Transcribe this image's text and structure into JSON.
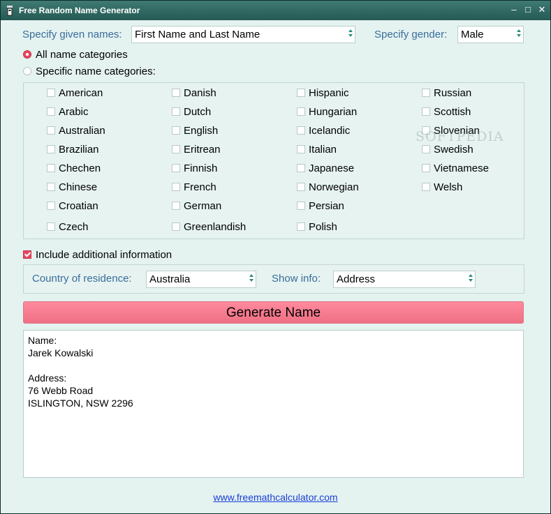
{
  "window": {
    "title": "Free Random Name Generator",
    "controls": {
      "minimize": "–",
      "maximize": "□",
      "close": "✕"
    }
  },
  "given_names": {
    "label": "Specify given names:",
    "value": "First Name and Last Name"
  },
  "gender": {
    "label": "Specify gender:",
    "value": "Male"
  },
  "categories_mode": {
    "all": {
      "label": "All name categories",
      "selected": true
    },
    "specific": {
      "label": "Specific name categories:",
      "selected": false
    }
  },
  "categories": [
    [
      "American",
      "Arabic",
      "Australian",
      "Brazilian",
      "Chechen",
      "Chinese",
      "Croatian",
      "Czech"
    ],
    [
      "Danish",
      "Dutch",
      "English",
      "Eritrean",
      "Finnish",
      "French",
      "German",
      "Greenlandish"
    ],
    [
      "Hispanic",
      "Hungarian",
      "Icelandic",
      "Italian",
      "Japanese",
      "Norwegian",
      "Persian",
      "Polish"
    ],
    [
      "Russian",
      "Scottish",
      "Slovenian",
      "Swedish",
      "Vietnamese",
      "Welsh"
    ]
  ],
  "additional_info": {
    "label": "Include additional information",
    "checked": true,
    "country_label": "Country of residence:",
    "country_value": "Australia",
    "show_label": "Show info:",
    "show_value": "Address"
  },
  "generate_button": "Generate Name",
  "output": {
    "name_heading": "Name:",
    "name_value": "Jarek Kowalski",
    "address_heading": "Address:",
    "address_line1": "76 Webb Road",
    "address_line2": "ISLINGTON, NSW 2296"
  },
  "footer": {
    "link": "www.freemathcalculator.com"
  },
  "watermark": "SOFTPEDIA",
  "colors": {
    "accent": "#e8465f",
    "title_bar": "#2f6a63",
    "label_blue": "#3a6d9a",
    "button_pink": "#f77d91"
  }
}
